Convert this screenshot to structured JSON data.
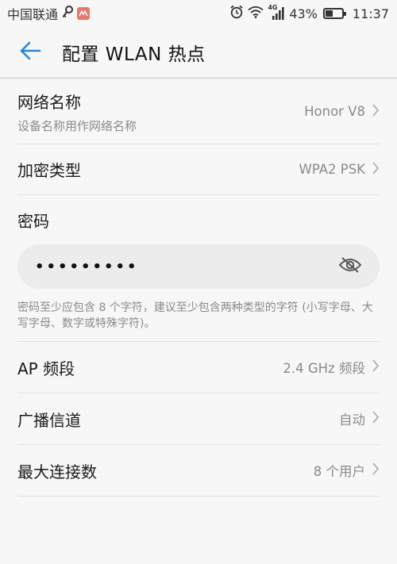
{
  "status_bar": {
    "carrier": "中国联通",
    "network_type": "4G",
    "battery_percent": "43%",
    "battery_level": 0.43,
    "time": "11:37"
  },
  "app_bar": {
    "back_icon": "arrow-left-icon",
    "title": "配置 WLAN 热点"
  },
  "settings": {
    "network_name": {
      "title": "网络名称",
      "subtitle": "设备名称用作网络名称",
      "value": "Honor V8"
    },
    "encryption": {
      "title": "加密类型",
      "value": "WPA2 PSK"
    },
    "password": {
      "label": "密码",
      "value": "•••••••••",
      "hint": "密码至少应包含 8 个字符，建议至少包含两种类型的字符 (小写字母、大写字母、数字或特殊字符)。"
    },
    "ap_band": {
      "title": "AP 频段",
      "value": "2.4 GHz 频段"
    },
    "channel": {
      "title": "广播信道",
      "value": "自动"
    },
    "max_connections": {
      "title": "最大连接数",
      "value": "8 个用户"
    }
  },
  "colors": {
    "accent": "#2a88d8",
    "background": "#f7f7f7",
    "secondary_text": "#8a8a8a"
  }
}
